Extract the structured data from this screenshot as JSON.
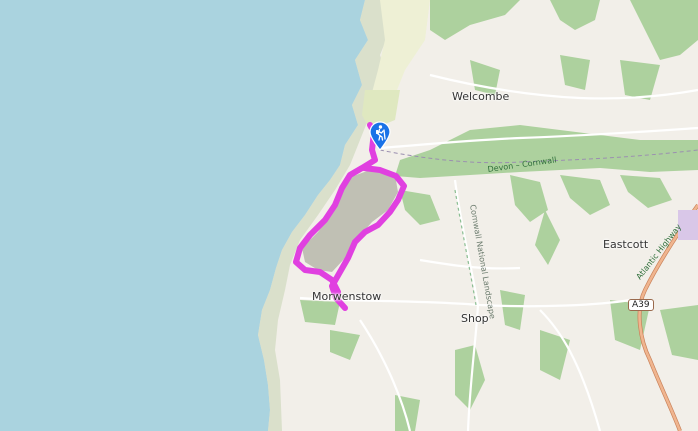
{
  "map": {
    "places": {
      "welcombe": "Welcombe",
      "eastcott": "Eastcott",
      "morwenstow": "Morwenstow",
      "shop": "Shop"
    },
    "roads": {
      "a39": "A39",
      "atlantic_highway": "Atlantic Highway",
      "devon_cornwall": "Devon – Cornwall"
    },
    "areas": {
      "cornwall_national_landscape": "Cornwall National Landscape"
    },
    "marker": {
      "icon": "hiker-icon",
      "color": "#1a73e8"
    },
    "route": {
      "color": "#e040e0",
      "type": "loop"
    },
    "colors": {
      "sea": "#aad3df",
      "land": "#f2efe9",
      "woodland": "#add19e",
      "farmland": "#eef0d5",
      "route": "#e040e0",
      "primary_road": "#e8a07a"
    }
  }
}
